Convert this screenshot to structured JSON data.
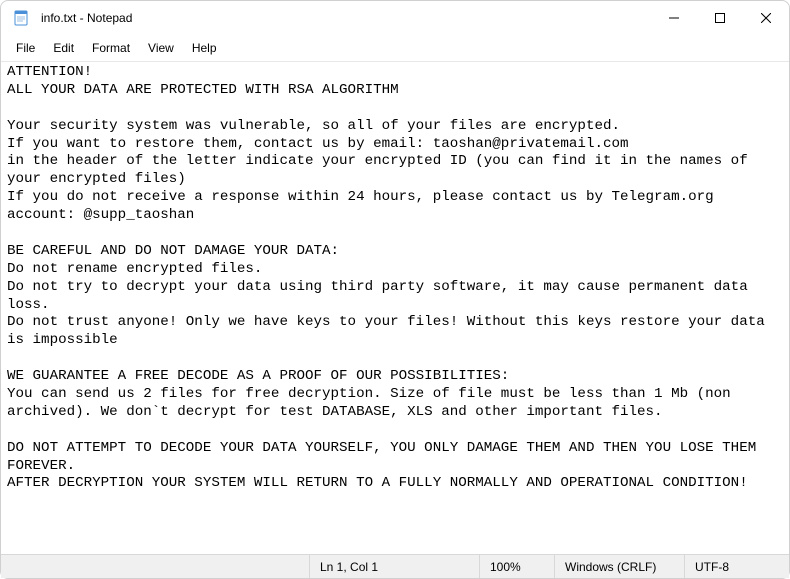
{
  "window": {
    "title": "info.txt - Notepad"
  },
  "menu": {
    "file": "File",
    "edit": "Edit",
    "format": "Format",
    "view": "View",
    "help": "Help"
  },
  "document": {
    "text": "ATTENTION!\nALL YOUR DATA ARE PROTECTED WITH RSA ALGORITHM\n\nYour security system was vulnerable, so all of your files are encrypted.\nIf you want to restore them, contact us by email: taoshan@privatemail.com\nin the header of the letter indicate your encrypted ID (you can find it in the names of your encrypted files)\nIf you do not receive a response within 24 hours, please contact us by Telegram.org account: @supp_taoshan\n\nBE CAREFUL AND DO NOT DAMAGE YOUR DATA:\nDo not rename encrypted files.\nDo not try to decrypt your data using third party software, it may cause permanent data loss.\nDo not trust anyone! Only we have keys to your files! Without this keys restore your data is impossible\n\nWE GUARANTEE A FREE DECODE AS A PROOF OF OUR POSSIBILITIES:\nYou can send us 2 files for free decryption. Size of file must be less than 1 Mb (non archived). We don`t decrypt for test DATABASE, XLS and other important files.\n\nDO NOT ATTEMPT TO DECODE YOUR DATA YOURSELF, YOU ONLY DAMAGE THEM AND THEN YOU LOSE THEM FOREVER.\nAFTER DECRYPTION YOUR SYSTEM WILL RETURN TO A FULLY NORMALLY AND OPERATIONAL CONDITION!"
  },
  "status": {
    "position": "Ln 1, Col 1",
    "zoom": "100%",
    "eol": "Windows (CRLF)",
    "encoding": "UTF-8"
  }
}
